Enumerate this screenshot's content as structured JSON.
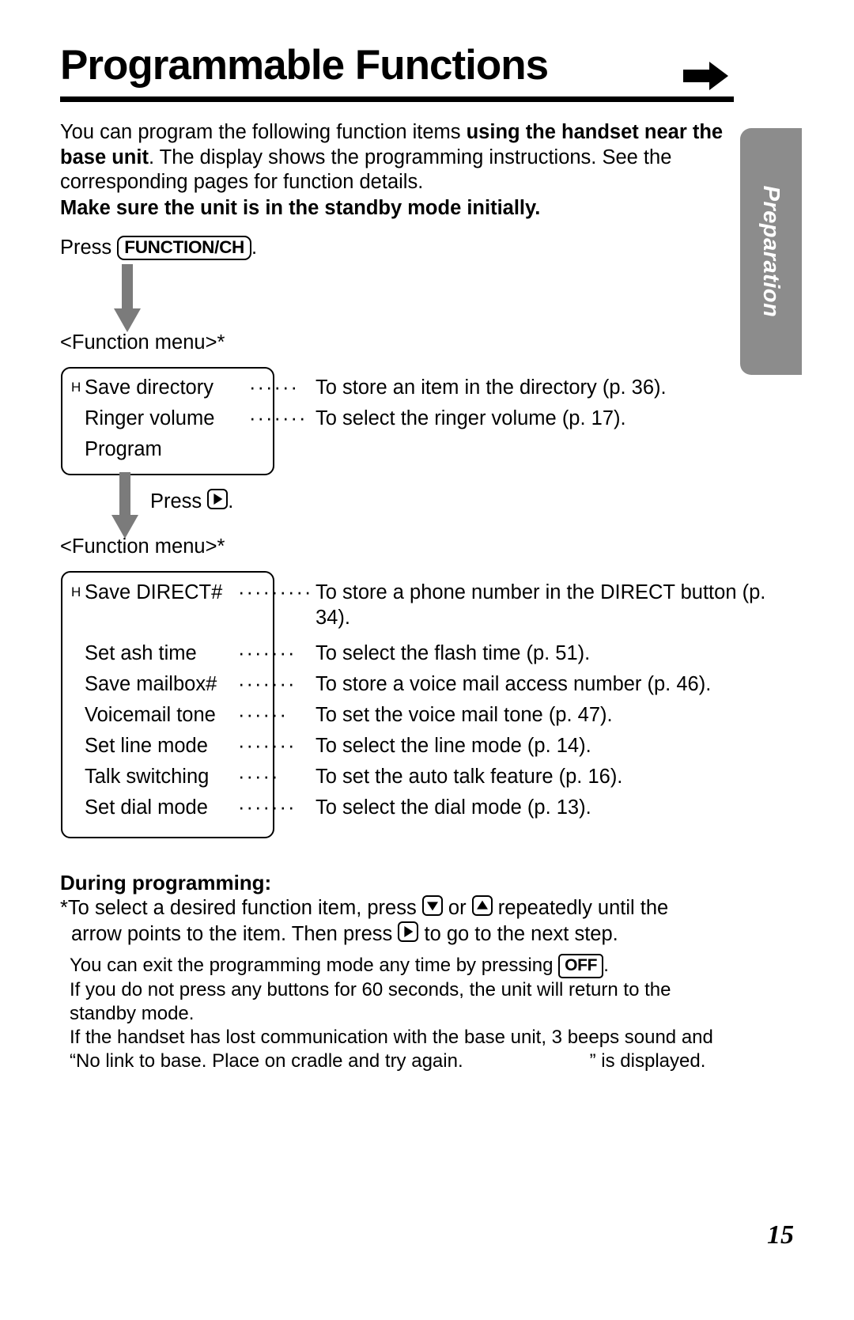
{
  "header": {
    "title": "Programmable Functions",
    "arrow_icon": "right-arrow-icon"
  },
  "side_tab": {
    "label": "Preparation"
  },
  "intro": {
    "line1_plain_a": "You can program the following function items ",
    "line1_bold": "using the handset near the base unit",
    "line1_plain_b": ". The display shows the programming instructions. See the corresponding pages for function details.",
    "make_sure": "Make sure the unit is in the standby mode initially."
  },
  "press_function": {
    "prefix": "Press ",
    "key_label": "FUNCTION/CH",
    "suffix": "."
  },
  "menu1": {
    "label": "<Function menu>*",
    "rows": [
      {
        "cursor": "H",
        "name": "Save directory",
        "dots": "······",
        "desc": "To store an item in the directory (p. 36)."
      },
      {
        "cursor": "",
        "name": "Ringer volume",
        "dots": "·······",
        "desc": "To select the ringer volume (p. 17)."
      },
      {
        "cursor": "",
        "name": "Program",
        "dots": "",
        "desc": ""
      }
    ]
  },
  "press_right": {
    "prefix": "Press ",
    "key_icon": "right-triangle-icon",
    "suffix": "."
  },
  "menu2": {
    "label": "<Function menu>*",
    "rows": [
      {
        "cursor": "H",
        "name": "Save DIRECT#",
        "dots": "·········",
        "desc": "To store a phone number in the DIRECT button (p. 34)."
      },
      {
        "cursor": "",
        "name": "Set  ash time",
        "dots": "·······",
        "desc": "To select the flash time (p. 51)."
      },
      {
        "cursor": "",
        "name": "Save mailbox#",
        "dots": "·······",
        "desc": "To store a voice mail access number (p. 46)."
      },
      {
        "cursor": "",
        "name": "Voicemail tone",
        "dots": "······",
        "desc": "To set the voice mail tone (p. 47)."
      },
      {
        "cursor": "",
        "name": "Set line mode",
        "dots": "·······",
        "desc": "To select the line mode (p. 14)."
      },
      {
        "cursor": "",
        "name": "Talk switching",
        "dots": "·····",
        "desc": "To set the auto talk feature (p. 16)."
      },
      {
        "cursor": "",
        "name": "Set dial mode",
        "dots": "·······",
        "desc": "To select the dial mode (p. 13)."
      }
    ]
  },
  "during": {
    "heading": "During programming:",
    "note_a": "*To select a desired function item, press ",
    "note_b": " or ",
    "note_c": " repeatedly until the",
    "note_d": "arrow points to the item. Then press ",
    "note_e": " to go to the next step.",
    "down_icon": "down-triangle-icon",
    "up_icon": "up-triangle-icon",
    "right_icon": "right-triangle-icon"
  },
  "tail": {
    "exit_a": "You can exit the programming mode any time by pressing ",
    "exit_key": "OFF",
    "exit_b": ".",
    "timeout": "If you do not press any buttons for 60 seconds, the unit will return to the standby mode.",
    "nolink_a": "If the handset has lost communication with the base unit, 3 beeps sound and “No link to base. Place on cradle and try again.",
    "nolink_b": "” is displayed."
  },
  "page_number": "15",
  "colors": {
    "arrow_gray": "#7b7b7b",
    "tab_gray": "#8c8c8c",
    "ink": "#000000"
  }
}
